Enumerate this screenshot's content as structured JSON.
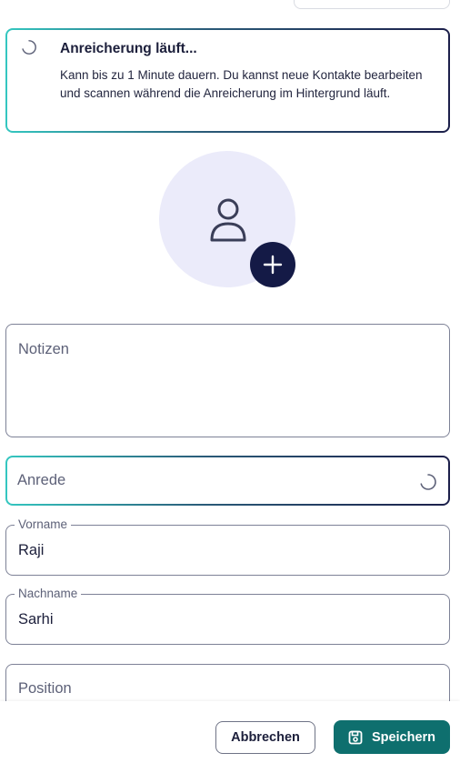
{
  "banner": {
    "title": "Anreicherung läuft...",
    "text": "Kann bis zu 1 Minute dauern. Du kannst neue Kontakte bearbeiten und scannen während die Anreicherung im Hintergrund läuft.",
    "spinner_icon": "loading-spinner-icon"
  },
  "avatar": {
    "person_icon": "person-icon",
    "add_icon": "plus-icon"
  },
  "form": {
    "notes": {
      "placeholder": "Notizen"
    },
    "salutation": {
      "placeholder": "Anrede",
      "spinner_icon": "loading-spinner-icon"
    },
    "first_name": {
      "label": "Vorname",
      "value": "Raji"
    },
    "last_name": {
      "label": "Nachname",
      "value": "Sarhi"
    },
    "position": {
      "placeholder": "Position"
    }
  },
  "footer": {
    "cancel_label": "Abbrechen",
    "save_label": "Speichern",
    "save_icon": "save-icon"
  },
  "colors": {
    "accent_primary": "#0e6f6e",
    "dark_navy": "#141a46",
    "avatar_bg": "#ebebfa",
    "gradient_start": "#34c7c0",
    "gradient_end": "#1c1f4a"
  }
}
